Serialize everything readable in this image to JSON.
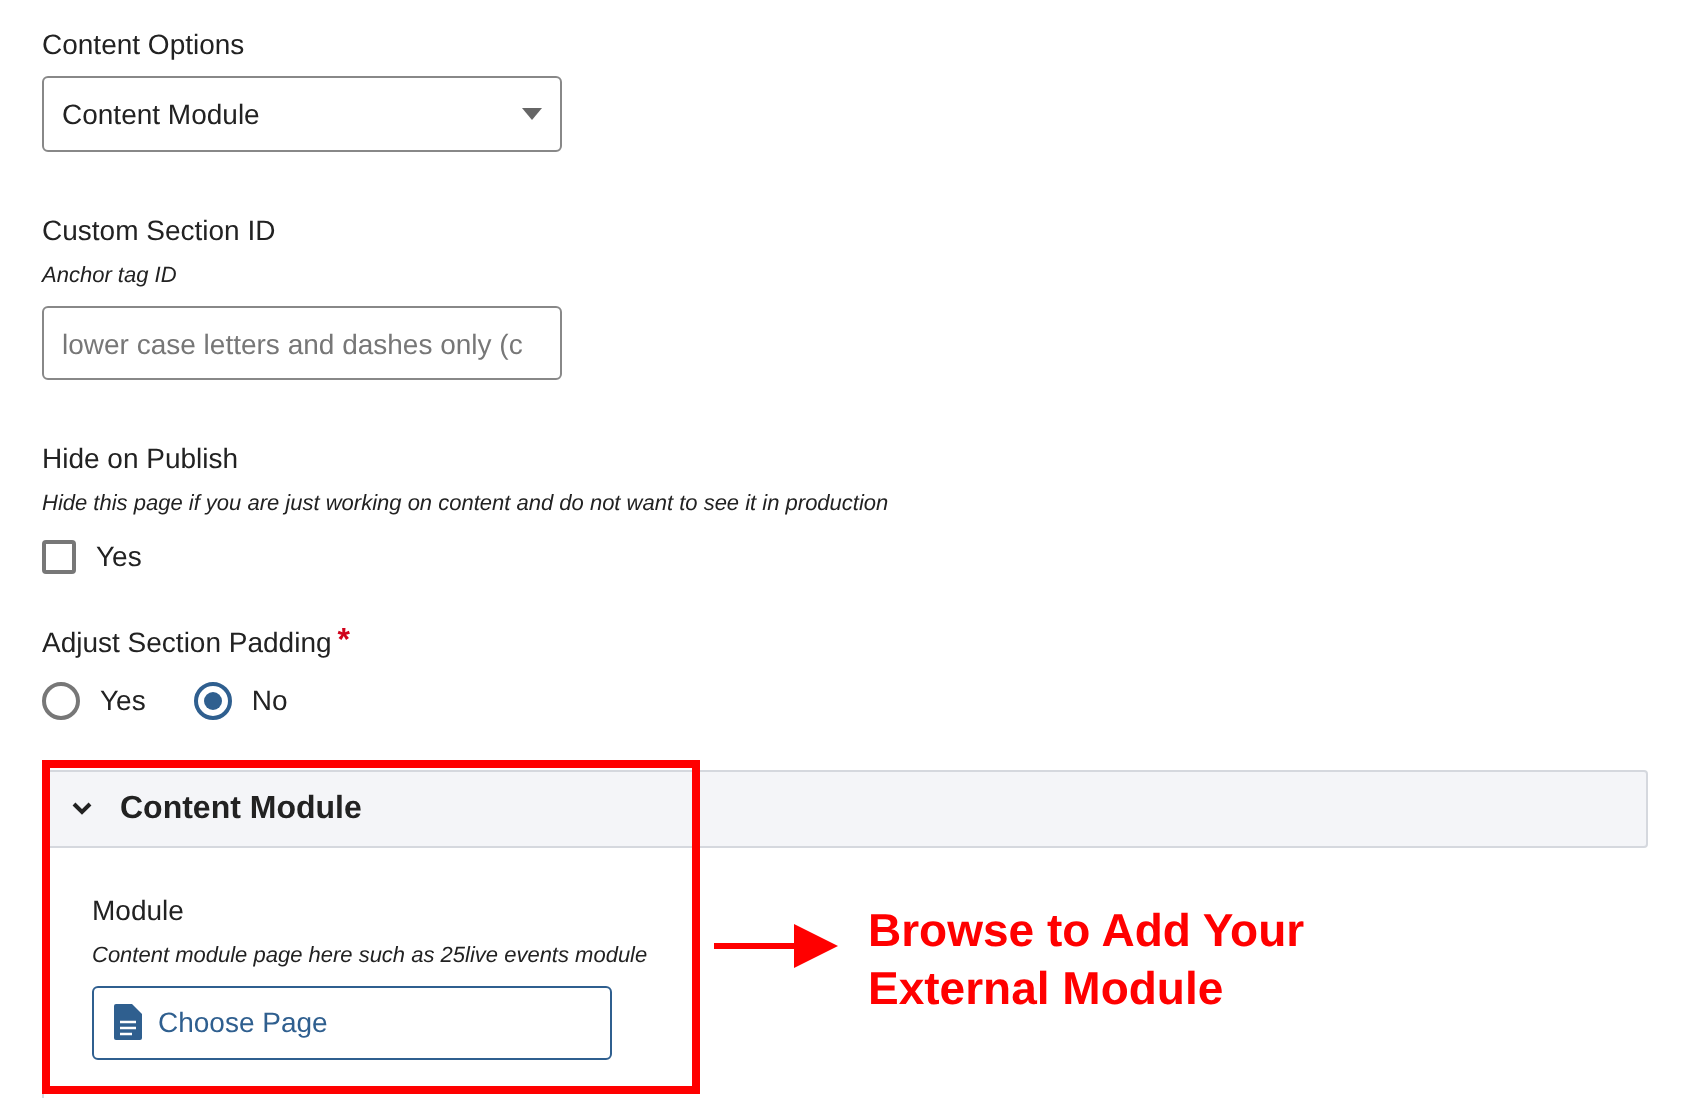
{
  "content_options": {
    "label": "Content Options",
    "value": "Content Module"
  },
  "custom_section_id": {
    "label": "Custom Section ID",
    "hint": "Anchor tag ID",
    "placeholder": "lower case letters and dashes only (c"
  },
  "hide_on_publish": {
    "label": "Hide on Publish",
    "hint": "Hide this page if you are just working on content and do not want to see it in production",
    "option": {
      "label": "Yes",
      "checked": false
    }
  },
  "adjust_section_padding": {
    "label": "Adjust Section Padding",
    "required_mark": "*",
    "options": [
      {
        "label": "Yes",
        "selected": false
      },
      {
        "label": "No",
        "selected": true
      }
    ]
  },
  "panel": {
    "title": "Content Module",
    "expanded": true,
    "module": {
      "label": "Module",
      "hint": "Content module page here such as 25live events module",
      "button": "Choose Page"
    }
  },
  "annotation": {
    "text": "Browse to Add Your External Module"
  }
}
